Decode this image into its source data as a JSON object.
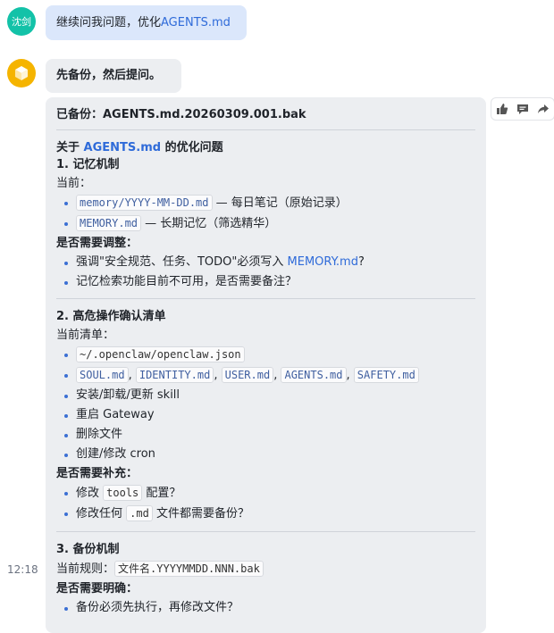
{
  "user_message": {
    "avatar_label": "沈剑",
    "text_prefix": "继续问我问题，优化",
    "text_link": "AGENTS.md"
  },
  "bot_reply_1": {
    "text": "先备份，然后提问。"
  },
  "bot_reply_2": {
    "backup_line": "已备份：AGENTS.md.20260309.001.bak",
    "intro": {
      "prefix": "关于 ",
      "link": "AGENTS.md",
      "suffix": " 的优化问题"
    },
    "sections": [
      {
        "title": "1. 记忆机制",
        "current_label": "当前：",
        "current_items": [
          {
            "code": "memory/YYYY-MM-DD.md",
            "text": " — 每日笔记（原始记录）"
          },
          {
            "code": "MEMORY.md",
            "text": " — 长期记忆（筛选精华）"
          }
        ],
        "question_label": "是否需要调整：",
        "question_items": [
          {
            "prefix": "强调\"安全规范、任务、TODO\"必须写入 ",
            "link": "MEMORY.md",
            "suffix": "?"
          },
          {
            "prefix": "记忆检索功能目前不可用，是否需要备注？"
          }
        ]
      },
      {
        "title": "2. 高危操作确认清单",
        "current_label": "当前清单：",
        "file_path": "~/.openclaw/openclaw.json",
        "files": [
          "SOUL.md",
          "IDENTITY.md",
          "USER.md",
          "AGENTS.md",
          "SAFETY.md"
        ],
        "file_separator": ",",
        "ops": [
          "安装/卸载/更新 skill",
          "重启 Gateway",
          "删除文件",
          "创建/修改 cron"
        ],
        "question_label": "是否需要补充：",
        "question_items": [
          {
            "prefix": "修改 ",
            "code": "tools",
            "suffix": " 配置？"
          },
          {
            "prefix": "修改任何 ",
            "code": ".md",
            "suffix": " 文件都需要备份？"
          }
        ]
      },
      {
        "title": "3. 备份机制",
        "rule_label": "当前规则：",
        "rule_code": "文件名.YYYYMMDD.NNN.bak",
        "question_label": "是否需要明确：",
        "question_items": [
          "备份必须先执行，再修改文件？"
        ]
      }
    ]
  },
  "timestamp": "12:18",
  "actions": [
    "thumbs-up-icon",
    "comment-icon",
    "share-icon"
  ],
  "colors": {
    "user_bubble": "#dbe7fb",
    "bot_bubble": "#eceef1",
    "link": "#2f6bd9",
    "user_avatar": "#13c2a8",
    "bot_avatar": "#f5b400"
  }
}
